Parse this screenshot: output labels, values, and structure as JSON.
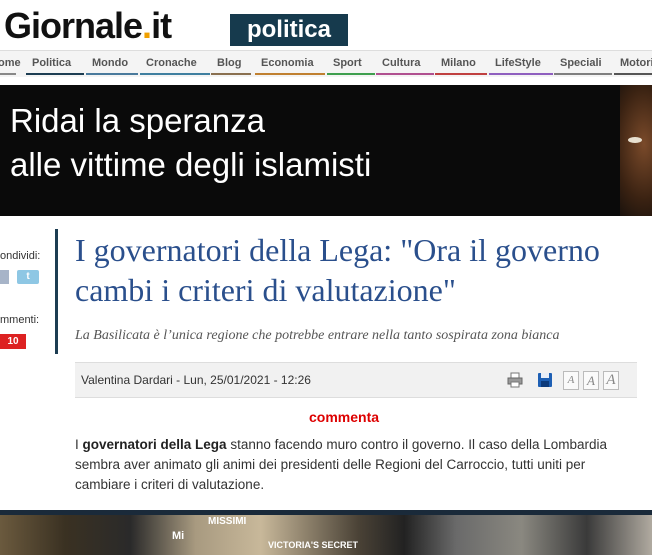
{
  "header": {
    "logo_main": "Giornale",
    "logo_dot": ".",
    "logo_suffix": "it",
    "section": "politica"
  },
  "nav": {
    "items": [
      {
        "label": "ome",
        "color": "#888888"
      },
      {
        "label": "Politica",
        "color": "#1c3d52"
      },
      {
        "label": "Mondo",
        "color": "#4a7a9c"
      },
      {
        "label": "Cronache",
        "color": "#3f7f9f"
      },
      {
        "label": "Blog",
        "color": "#8a7050"
      },
      {
        "label": "Economia",
        "color": "#c08030"
      },
      {
        "label": "Sport",
        "color": "#3f9f4f"
      },
      {
        "label": "Cultura",
        "color": "#b05090"
      },
      {
        "label": "Milano",
        "color": "#c04040"
      },
      {
        "label": "LifeStyle",
        "color": "#8f5fbf"
      },
      {
        "label": "Speciali",
        "color": "#7f7f7f"
      },
      {
        "label": "Motori",
        "color": "#555555"
      }
    ]
  },
  "banner": {
    "line1": "Ridai la speranza",
    "line2": "alle vittime degli islamisti"
  },
  "share": {
    "label": "ondividi:",
    "twitter_glyph": "t",
    "comments_label": "mmenti:",
    "comments_count": "10"
  },
  "article": {
    "title": "I governatori della Lega: \"Ora il governo cambi i criteri di valutazione\"",
    "subtitle": "La Basilicata è l’unica regione che potrebbe entrare nella tanto sospirata zona bianca",
    "meta": "Valentina Dardari - Lun, 25/01/2021 - 12:26",
    "font_sizes": [
      "A",
      "A",
      "A"
    ],
    "commenta": "commenta",
    "body_prefix": "I ",
    "body_bold": "governatori della Lega",
    "body_rest": " stanno facendo muro contro il governo. Il caso della Lombardia sembra aver animato gli animi dei presidenti delle Regioni del Carroccio, tutti uniti per cambiare i criteri di valutazione."
  },
  "photo": {
    "sign1": "Mi",
    "sign2": "MISSIMI",
    "sign3": "VICTORIA'S SECRET"
  }
}
